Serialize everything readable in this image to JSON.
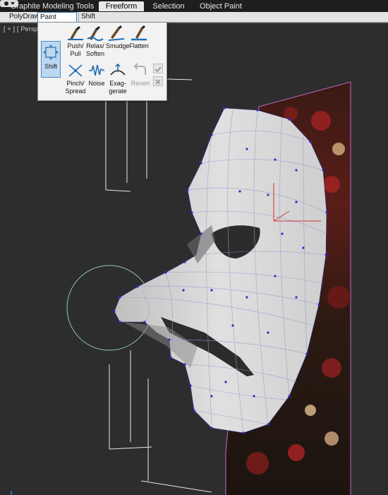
{
  "ribbon": {
    "tabs": [
      {
        "label": "Graphite Modeling Tools",
        "active": false
      },
      {
        "label": "Freeform",
        "active": true
      },
      {
        "label": "Selection",
        "active": false
      },
      {
        "label": "Object Paint",
        "active": false
      }
    ]
  },
  "subtabs": {
    "polydraw": "PolyDraw",
    "paint_deform": "Paint Deform",
    "shift_options": "Shift Options"
  },
  "viewport": {
    "label": "[ + ] [ Perspec"
  },
  "panel": {
    "shift_label": "Shift",
    "tools_row1": [
      {
        "label1": "Push/",
        "label2": "Pull",
        "icon": "push-pull-icon"
      },
      {
        "label1": "Relax/",
        "label2": "Soften",
        "icon": "relax-soften-icon"
      },
      {
        "label1": "Smudge",
        "label2": "",
        "icon": "smudge-icon"
      },
      {
        "label1": "Flatten",
        "label2": "",
        "icon": "flatten-icon"
      }
    ],
    "tools_row2": [
      {
        "label1": "Pinch/",
        "label2": "Spread",
        "icon": "pinch-spread-icon"
      },
      {
        "label1": "Noise",
        "label2": "",
        "icon": "noise-icon"
      },
      {
        "label1": "Exag-",
        "label2": "gerate",
        "icon": "exaggerate-icon"
      },
      {
        "label1": "Revert",
        "label2": "",
        "icon": "revert-icon"
      }
    ]
  },
  "colors": {
    "accent": "#3c7fb1",
    "mesh_face": "#d6d6d6",
    "mesh_vertex": "#2a2ad0",
    "brush_circle": "#8fc9a6",
    "axis_x": "#d33030"
  }
}
